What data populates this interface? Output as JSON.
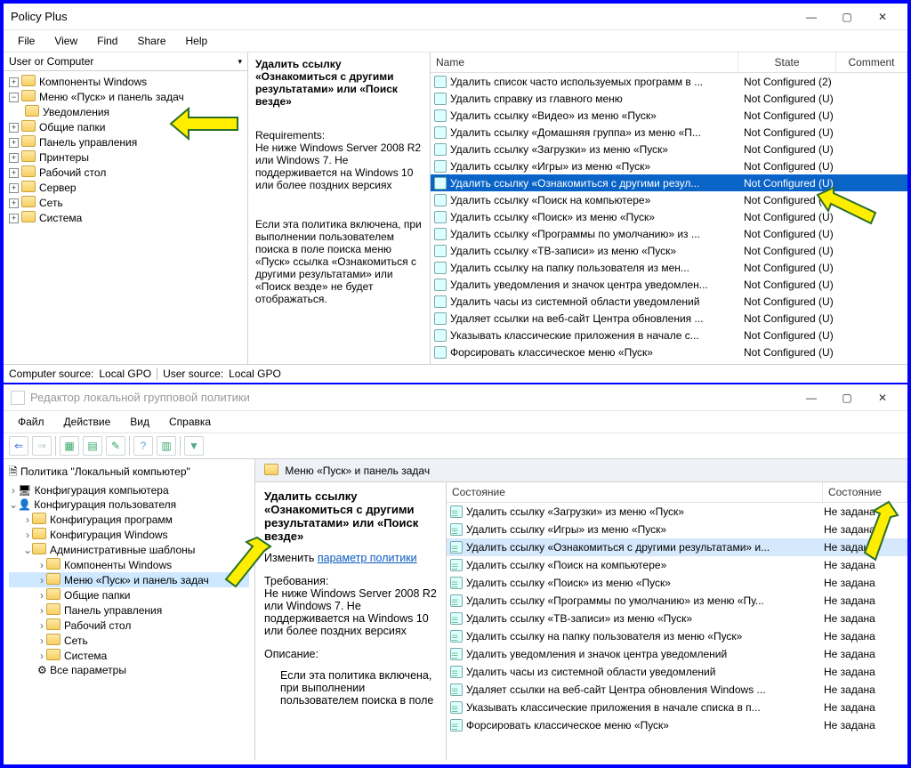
{
  "top": {
    "title": "Policy Plus",
    "menu": [
      "File",
      "View",
      "Find",
      "Share",
      "Help"
    ],
    "treeHeader": "User or Computer",
    "tree": [
      {
        "label": "Компоненты Windows"
      },
      {
        "label": "Меню «Пуск» и панель задач",
        "children": [
          {
            "label": "Уведомления"
          }
        ]
      },
      {
        "label": "Общие папки"
      },
      {
        "label": "Панель управления"
      },
      {
        "label": "Принтеры"
      },
      {
        "label": "Рабочий стол"
      },
      {
        "label": "Сервер"
      },
      {
        "label": "Сеть"
      },
      {
        "label": "Система"
      }
    ],
    "desc": {
      "title": "Удалить ссылку «Ознакомиться с другими результатами» или «Поиск везде»",
      "reqLabel": "Requirements:",
      "req": "Не ниже Windows Server 2008 R2 или Windows 7. Не поддерживается на Windows 10 или более поздних версиях",
      "body": "Если эта политика включена, при выполнении пользователем поиска в поле поиска меню «Пуск» ссылка «Ознакомиться с другими результатами» или «Поиск везде» не будет отображаться."
    },
    "cols": {
      "name": "Name",
      "state": "State",
      "comment": "Comment"
    },
    "policies": [
      {
        "n": "Удалить список часто используемых программ в ...",
        "s": "Not Configured (2)"
      },
      {
        "n": "Удалить справку из главного меню",
        "s": "Not Configured (U)"
      },
      {
        "n": "Удалить ссылку «Видео» из меню «Пуск»",
        "s": "Not Configured (U)"
      },
      {
        "n": "Удалить ссылку «Домашняя группа» из меню «П...",
        "s": "Not Configured (U)"
      },
      {
        "n": "Удалить ссылку «Загрузки» из меню «Пуск»",
        "s": "Not Configured (U)"
      },
      {
        "n": "Удалить ссылку «Игры» из меню «Пуск»",
        "s": "Not Configured (U)"
      },
      {
        "n": "Удалить ссылку «Ознакомиться с другими резул...",
        "s": "Not Configured (U)",
        "sel": true
      },
      {
        "n": "Удалить ссылку «Поиск на компьютере»",
        "s": "Not Configured (U)"
      },
      {
        "n": "Удалить ссылку «Поиск» из меню «Пуск»",
        "s": "Not Configured (U)"
      },
      {
        "n": "Удалить ссылку «Программы по умолчанию» из ...",
        "s": "Not Configured (U)"
      },
      {
        "n": "Удалить ссылку «ТВ-записи» из меню «Пуск»",
        "s": "Not Configured (U)"
      },
      {
        "n": "Удалить ссылку на папку пользователя из мен...",
        "s": "Not Configured (U)"
      },
      {
        "n": "Удалить уведомления и значок центра уведомлен...",
        "s": "Not Configured (U)"
      },
      {
        "n": "Удалить часы из системной области уведомлений",
        "s": "Not Configured (U)"
      },
      {
        "n": "Удаляет ссылки на веб-сайт Центра обновления ...",
        "s": "Not Configured (U)"
      },
      {
        "n": "Указывать классические приложения в начале с...",
        "s": "Not Configured (U)"
      },
      {
        "n": "Форсировать классическое меню «Пуск»",
        "s": "Not Configured (U)"
      }
    ],
    "status": {
      "l1": "Computer source:",
      "v1": "Local GPO",
      "l2": "User source:",
      "v2": "Local GPO"
    }
  },
  "bot": {
    "title": "Редактор локальной групповой политики",
    "menu": [
      "Файл",
      "Действие",
      "Вид",
      "Справка"
    ],
    "tree": {
      "root": "Политика \"Локальный компьютер\"",
      "cfgComp": "Конфигурация компьютера",
      "cfgUser": "Конфигурация пользователя",
      "children": [
        "Конфигурация программ",
        "Конфигурация Windows"
      ],
      "admin": "Административные шаблоны",
      "adminChildren": [
        "Компоненты Windows",
        "Меню «Пуск» и панель задач",
        "Общие папки",
        "Панель управления",
        "Рабочий стол",
        "Сеть",
        "Система",
        "Все параметры"
      ],
      "selIndex": 1
    },
    "breadcrumb": "Меню «Пуск» и панель задач",
    "desc": {
      "title": "Удалить ссылку «Ознакомиться с другими результатами» или «Поиск везде»",
      "editLabel": "Изменить",
      "editLink": "параметр политики",
      "reqLabel": "Требования:",
      "req": "Не ниже Windows Server 2008 R2 или Windows 7. Не поддерживается на Windows 10 или более поздних версиях",
      "descLabel": "Описание:",
      "body": "Если эта политика включена, при выполнении пользователем поиска в поле"
    },
    "cols": {
      "name": "Состояние",
      "state": "Состояние"
    },
    "policies": [
      {
        "n": "Удалить ссылку «Загрузки» из меню «Пуск»",
        "s": "Не задана"
      },
      {
        "n": "Удалить ссылку «Игры» из меню «Пуск»",
        "s": "Не задана"
      },
      {
        "n": "Удалить ссылку «Ознакомиться с другими результатами» и...",
        "s": "Не задана",
        "sel": true
      },
      {
        "n": "Удалить ссылку «Поиск на компьютере»",
        "s": "Не задана"
      },
      {
        "n": "Удалить ссылку «Поиск» из меню «Пуск»",
        "s": "Не задана"
      },
      {
        "n": "Удалить ссылку «Программы по умолчанию» из меню «Пу...",
        "s": "Не задана"
      },
      {
        "n": "Удалить ссылку «ТВ-записи» из меню «Пуск»",
        "s": "Не задана"
      },
      {
        "n": "Удалить ссылку на папку пользователя из меню «Пуск»",
        "s": "Не задана"
      },
      {
        "n": "Удалить уведомления и значок центра уведомлений",
        "s": "Не задана"
      },
      {
        "n": "Удалить часы из системной области уведомлений",
        "s": "Не задана"
      },
      {
        "n": "Удаляет ссылки на веб-сайт Центра обновления Windows ...",
        "s": "Не задана"
      },
      {
        "n": "Указывать классические приложения в начале списка в п...",
        "s": "Не задана"
      },
      {
        "n": "Форсировать классическое меню «Пуск»",
        "s": "Не задана"
      }
    ]
  }
}
